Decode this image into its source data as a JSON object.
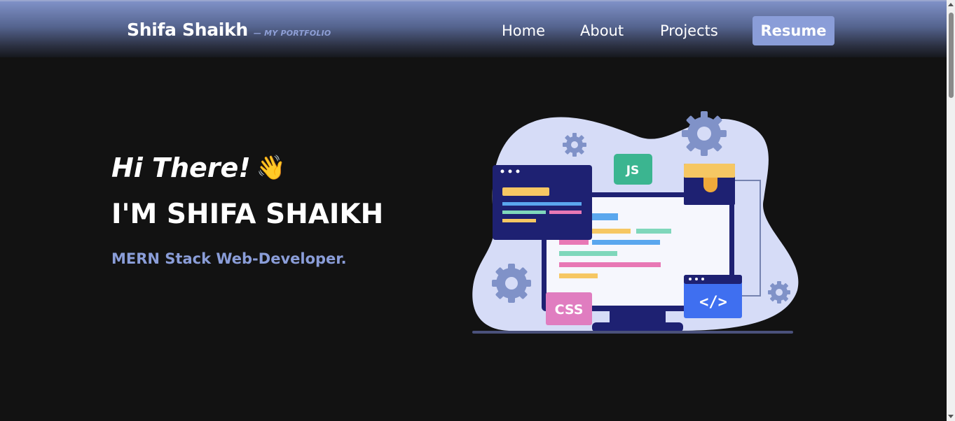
{
  "brand": {
    "name": "Shifa Shaikh",
    "tagline": "— MY PORTFOLIO"
  },
  "nav": {
    "items": [
      {
        "label": "Home"
      },
      {
        "label": "About"
      },
      {
        "label": "Projects"
      }
    ],
    "resume_label": "Resume"
  },
  "hero": {
    "greeting": "Hi There!",
    "greeting_icon": "waving-hand-icon",
    "headline": "I'M SHIFA SHAIKH",
    "subtitle": "MERN Stack Web-Developer.",
    "illustration_labels": {
      "js": "JS",
      "css": "CSS",
      "code": "</>"
    }
  },
  "colors": {
    "background": "#121212",
    "accent": "#8a9dd8",
    "nav_gradient_top": "#7f91c7",
    "text": "#ffffff"
  }
}
